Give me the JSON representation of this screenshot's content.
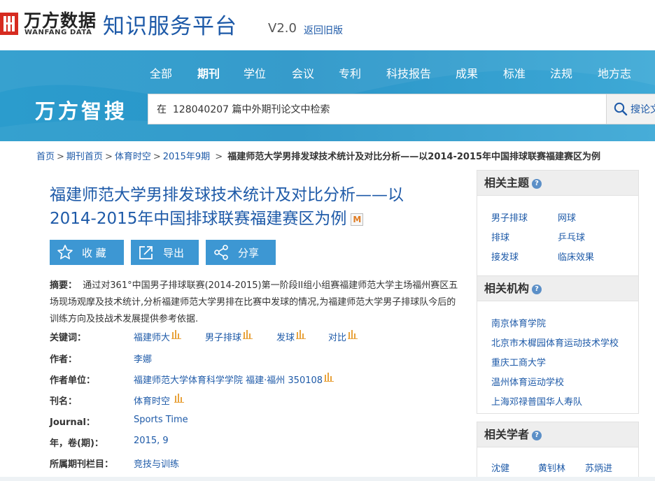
{
  "header": {
    "logo_cn": "万方数据",
    "logo_en": "WANFANG DATA",
    "platform_title": "知识服务平台",
    "version": "V2.0",
    "old_version_link": "返回旧版"
  },
  "nav": {
    "items": [
      {
        "label": "全部"
      },
      {
        "label": "期刊",
        "active": true
      },
      {
        "label": "学位"
      },
      {
        "label": "会议"
      },
      {
        "label": "专利"
      },
      {
        "label": "科技报告"
      },
      {
        "label": "成果"
      },
      {
        "label": "标准"
      },
      {
        "label": "法规"
      },
      {
        "label": "地方志"
      }
    ]
  },
  "search": {
    "brand": "万方智搜",
    "value": "在  128040207 篇中外期刊论文中检索",
    "button_label": "搜论文"
  },
  "breadcrumb": {
    "items": [
      "首页",
      "期刊首页",
      "体育时空",
      "2015年9期"
    ],
    "current": "福建师范大学男排发球技术统计及对比分析——以2014-2015年中国排球联赛福建赛区为例"
  },
  "article": {
    "title": "福建师范大学男排发球技术统计及对比分析——以2014-2015年中国排球联赛福建赛区为例",
    "badge": "M",
    "actions": {
      "collect": "收 藏",
      "export": "导出",
      "share": "分享"
    },
    "abstract_label": "摘要：",
    "abstract": "通过对361°中国男子排球联赛(2014-2015)第一阶段II组小组赛福建师范大学主场福州赛区五场现场观摩及技术统计,分析福建师范大学男排在比赛中发球的情况,为福建师范大学男子排球队今后的训练方向及技战术发展提供参考依据.",
    "keywords_label": "关键词：",
    "keywords": [
      "福建师大",
      "男子排球",
      "发球",
      "对比"
    ],
    "author_label": "作者：",
    "author": "李娜",
    "affiliation_label": "作者单位：",
    "affiliation": "福建师范大学体育科学学院 福建·福州 350108",
    "journal_cn_label": "刊名：",
    "journal_cn": "体育时空",
    "journal_en_label": "Journal：",
    "journal_en": "Sports Time",
    "issue_label": "年，卷(期)：",
    "issue": "2015, 9",
    "column_label": "所属期刊栏目：",
    "column": "竞技与训练"
  },
  "sidebar": {
    "topics": {
      "title": "相关主题",
      "items": [
        "男子排球",
        "网球",
        "排球",
        "乒乓球",
        "接发球",
        "临床效果"
      ]
    },
    "institutions": {
      "title": "相关机构",
      "items": [
        "南京体育学院",
        "北京市木樨园体育运动技术学校",
        "重庆工商大学",
        "温州体育运动学校",
        "上海邓禄普国华人寿队"
      ]
    },
    "scholars": {
      "title": "相关学者",
      "items": [
        "沈健",
        "黄钊林",
        "苏炳进"
      ]
    }
  },
  "colors": {
    "brand_blue": "#1e5aa8",
    "banner_blue": "#2b9ccd",
    "button_blue": "#3d97d3",
    "logo_red": "#d62b20",
    "chart_icon_orange": "#e8a33d"
  }
}
